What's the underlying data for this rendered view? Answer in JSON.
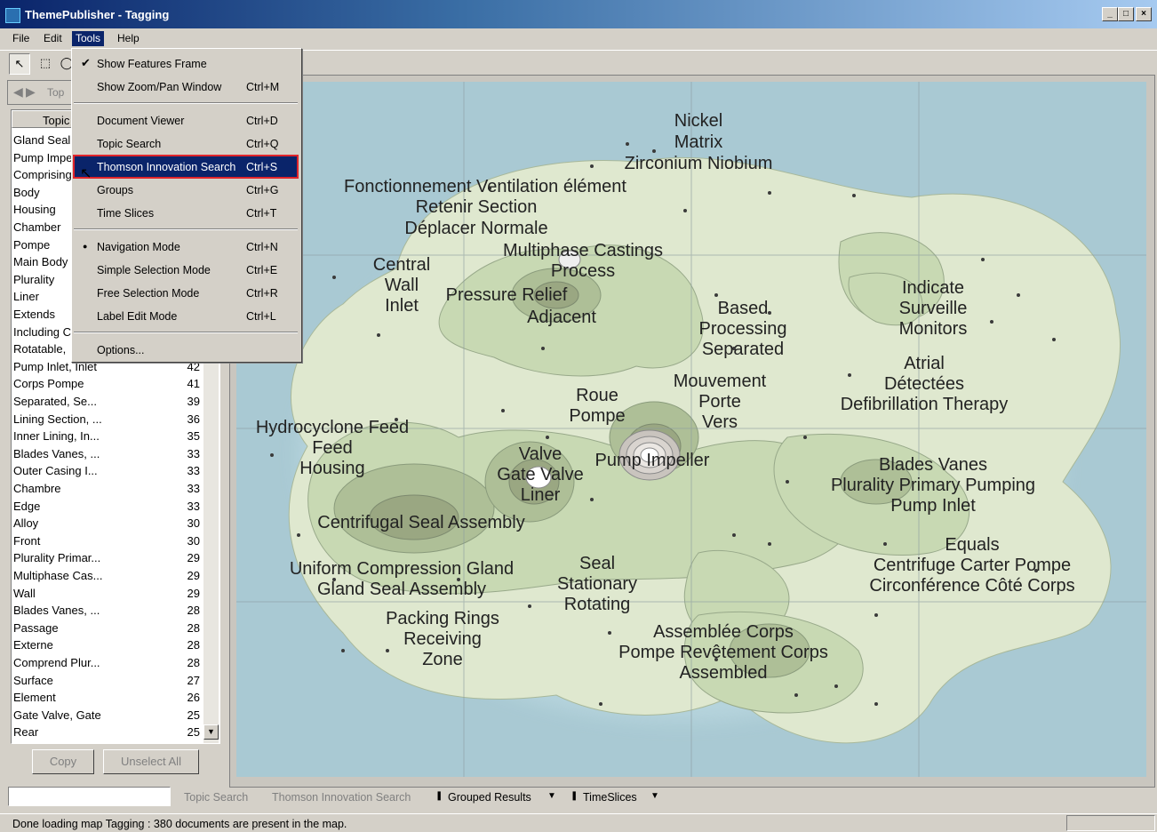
{
  "window": {
    "title": "ThemePublisher - Tagging",
    "min": "_",
    "max": "□",
    "close": "×"
  },
  "menubar": [
    "File",
    "Edit",
    "Tools",
    "Help"
  ],
  "tools_menu": [
    {
      "label": "Show Features Frame",
      "shortcut": "",
      "mark": "check"
    },
    {
      "label": "Show Zoom/Pan Window",
      "shortcut": "Ctrl+M",
      "mark": ""
    },
    {
      "label": "Document Viewer",
      "shortcut": "Ctrl+D",
      "mark": ""
    },
    {
      "label": "Topic Search",
      "shortcut": "Ctrl+Q",
      "mark": ""
    },
    {
      "label": "Thomson Innovation Search",
      "shortcut": "Ctrl+S",
      "mark": "",
      "highlighted": true
    },
    {
      "label": "Groups",
      "shortcut": "Ctrl+G",
      "mark": ""
    },
    {
      "label": "Time Slices",
      "shortcut": "Ctrl+T",
      "mark": ""
    },
    {
      "label": "Navigation Mode",
      "shortcut": "Ctrl+N",
      "mark": "radio"
    },
    {
      "label": "Simple Selection Mode",
      "shortcut": "Ctrl+E",
      "mark": ""
    },
    {
      "label": "Free Selection Mode",
      "shortcut": "Ctrl+R",
      "mark": ""
    },
    {
      "label": "Label Edit Mode",
      "shortcut": "Ctrl+L",
      "mark": ""
    },
    {
      "label": "Options...",
      "shortcut": "",
      "mark": ""
    }
  ],
  "left_panel": {
    "nav_label": "Top",
    "column_header": "Topic",
    "rows": [
      {
        "name": "Gland Seal",
        "count": ""
      },
      {
        "name": "Pump Impe",
        "count": ""
      },
      {
        "name": "Comprising",
        "count": ""
      },
      {
        "name": "Body",
        "count": ""
      },
      {
        "name": "Housing",
        "count": ""
      },
      {
        "name": "Chamber",
        "count": ""
      },
      {
        "name": "Pompe",
        "count": ""
      },
      {
        "name": "Main Body",
        "count": ""
      },
      {
        "name": "Plurality",
        "count": ""
      },
      {
        "name": "Liner",
        "count": ""
      },
      {
        "name": "Extends",
        "count": ""
      },
      {
        "name": "Including C",
        "count": ""
      },
      {
        "name": "Rotatable,",
        "count": ""
      },
      {
        "name": "Pump Inlet, Inlet",
        "count": "42"
      },
      {
        "name": "Corps Pompe",
        "count": "41"
      },
      {
        "name": "Separated, Se...",
        "count": "39"
      },
      {
        "name": "Lining Section, ...",
        "count": "36"
      },
      {
        "name": "Inner Lining, In...",
        "count": "35"
      },
      {
        "name": "Blades Vanes, ...",
        "count": "33"
      },
      {
        "name": "Outer Casing I...",
        "count": "33"
      },
      {
        "name": "Chambre",
        "count": "33"
      },
      {
        "name": "Edge",
        "count": "33"
      },
      {
        "name": "Alloy",
        "count": "30"
      },
      {
        "name": "Front",
        "count": "30"
      },
      {
        "name": "Plurality Primar...",
        "count": "29"
      },
      {
        "name": "Multiphase Cas...",
        "count": "29"
      },
      {
        "name": "Wall",
        "count": "29"
      },
      {
        "name": "Blades Vanes, ...",
        "count": "28"
      },
      {
        "name": "Passage",
        "count": "28"
      },
      {
        "name": "Externe",
        "count": "28"
      },
      {
        "name": "Comprend Plur...",
        "count": "28"
      },
      {
        "name": "Surface",
        "count": "27"
      },
      {
        "name": "Element",
        "count": "26"
      },
      {
        "name": "Gate Valve, Gate",
        "count": "25"
      },
      {
        "name": "Rear",
        "count": "25"
      }
    ],
    "copy_button": "Copy",
    "unselect_button": "Unselect All"
  },
  "map_labels": [
    [
      "Nickel",
      "Matrix",
      "Zirconium Niobium"
    ],
    [
      "Fonctionnement Ventilation élément",
      "Retenir Section",
      "Déplacer Normale"
    ],
    [
      "Multiphase Castings",
      "Process"
    ],
    [
      "Central",
      "Wall",
      "Inlet"
    ],
    [
      "Pressure Relief",
      "Adjacent"
    ],
    [
      "Based",
      "Processing",
      "Separated"
    ],
    [
      "Indicate",
      "Surveille",
      "Monitors"
    ],
    [
      "Atrial",
      "Détectées",
      "Defibrillation Therapy"
    ],
    [
      "Mouvement",
      "Porte",
      "Vers"
    ],
    [
      "Roue",
      "Pompe"
    ],
    [
      "Hydrocyclone Feed",
      "Feed",
      "Housing"
    ],
    [
      "Valve",
      "Gate Valve",
      "Liner"
    ],
    [
      "Pump Impeller"
    ],
    [
      "Blades Vanes",
      "Plurality Primary Pumping",
      "Pump Inlet"
    ],
    [
      "Centrifugal Seal Assembly"
    ],
    [
      "Equals",
      "Centrifuge Carter Pompe",
      "Circonférence Côté Corps"
    ],
    [
      "Uniform Compression Gland",
      "Gland Seal Assembly"
    ],
    [
      "Seal",
      "Stationary",
      "Rotating"
    ],
    [
      "Packing Rings",
      "Receiving",
      "Zone"
    ],
    [
      "Assemblée Corps",
      "Pompe Revêtement Corps",
      "Assembled"
    ]
  ],
  "bottom_bar": {
    "search_value": "",
    "topic_search": "Topic Search",
    "thomson_search": "Thomson Innovation Search",
    "grouped_results": "Grouped Results",
    "time_slices": "TimeSlices"
  },
  "status": "Done loading map Tagging : 380  documents are present in the map."
}
